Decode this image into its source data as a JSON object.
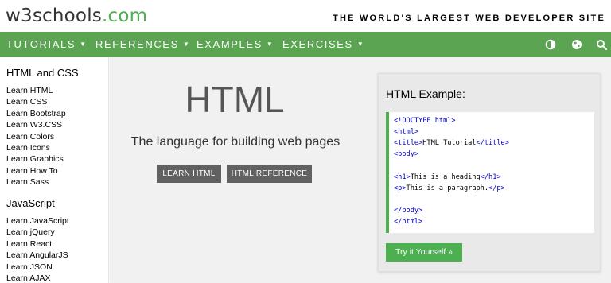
{
  "header": {
    "logo_main": "w3schools",
    "logo_suffix": ".com",
    "tagline": "THE WORLD'S LARGEST WEB DEVELOPER SITE"
  },
  "nav": {
    "items": [
      {
        "label": "TUTORIALS"
      },
      {
        "label": "REFERENCES"
      },
      {
        "label": "EXAMPLES"
      },
      {
        "label": "EXERCISES"
      }
    ],
    "icons": [
      "contrast-icon",
      "globe-icon",
      "search-icon"
    ]
  },
  "sidebar": {
    "section1": {
      "heading": "HTML and CSS",
      "links": [
        "Learn HTML",
        "Learn CSS",
        "Learn Bootstrap",
        "Learn W3.CSS",
        "Learn Colors",
        "Learn Icons",
        "Learn Graphics",
        "Learn How To",
        "Learn Sass"
      ]
    },
    "section2": {
      "heading": "JavaScript",
      "links": [
        "Learn JavaScript",
        "Learn jQuery",
        "Learn React",
        "Learn AngularJS",
        "Learn JSON",
        "Learn AJAX"
      ]
    }
  },
  "hero": {
    "title": "HTML",
    "subtitle": "The language for building web pages",
    "btn_learn": "LEARN HTML",
    "btn_reference": "HTML REFERENCE"
  },
  "example": {
    "title": "HTML Example:",
    "code": {
      "l1": "<!DOCTYPE html>",
      "l2": "<html>",
      "l3_open": "<title>",
      "l3_text": "HTML Tutorial",
      "l3_close": "</title>",
      "l4": "<body>",
      "l5_open": "<h1>",
      "l5_text": "This is a heading",
      "l5_close": "</h1>",
      "l6_open": "<p>",
      "l6_text": "This is a paragraph.",
      "l6_close": "</p>",
      "l7": "</body>",
      "l8": "</html>"
    },
    "try_button": "Try it Yourself »"
  },
  "colors": {
    "brand_green": "#4CAF50",
    "nav_green": "#5aa452",
    "dark_button": "#616161"
  }
}
